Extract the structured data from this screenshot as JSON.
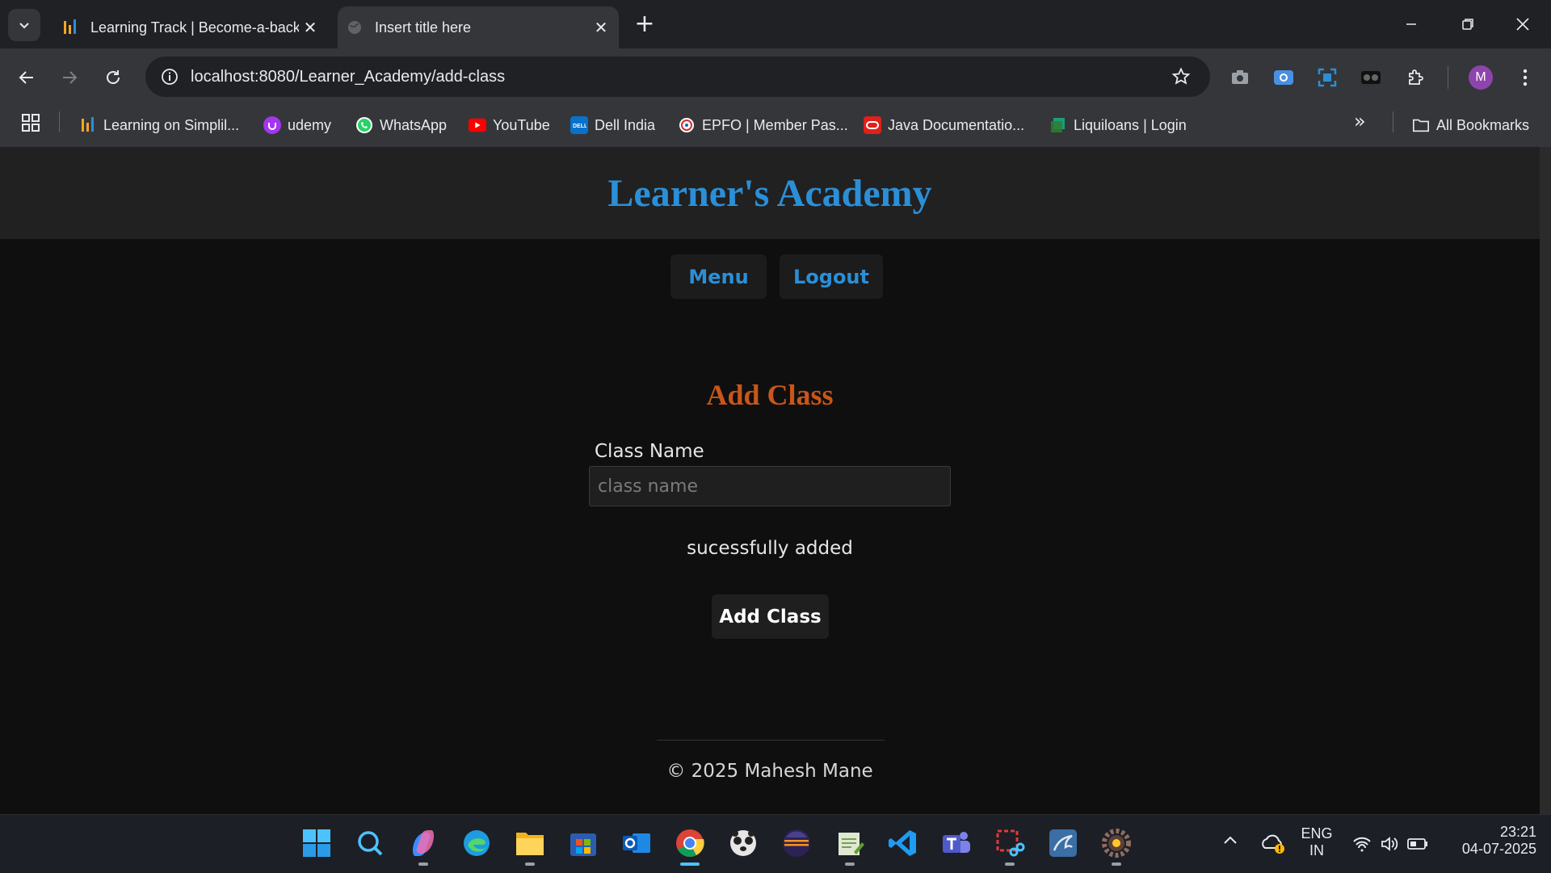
{
  "browser": {
    "tabs": [
      {
        "title": "Learning Track | Become-a-back",
        "active": false
      },
      {
        "title": "Insert title here",
        "active": true
      }
    ],
    "new_tab": "+",
    "url": "localhost:8080/Learner_Academy/add-class",
    "bookmarks": [
      {
        "label": "Learning on Simplil...",
        "icon": "simplilearn-icon"
      },
      {
        "label": "udemy",
        "icon": "udemy-icon"
      },
      {
        "label": "WhatsApp",
        "icon": "whatsapp-icon"
      },
      {
        "label": "YouTube",
        "icon": "youtube-icon"
      },
      {
        "label": "Dell India",
        "icon": "dell-icon"
      },
      {
        "label": "EPFO | Member Pas...",
        "icon": "epfo-icon"
      },
      {
        "label": "Java Documentatio...",
        "icon": "oracle-icon"
      },
      {
        "label": "Liquiloans | Login",
        "icon": "liquiloans-icon"
      }
    ],
    "all_bookmarks": "All Bookmarks",
    "avatar_letter": "M"
  },
  "page": {
    "site_title": "Learner's Academy",
    "nav": {
      "menu": "Menu",
      "logout": "Logout"
    },
    "form_title": "Add Class",
    "class_name_label": "Class Name",
    "class_name_placeholder": "class name",
    "message": "sucessfully added",
    "submit_label": "Add Class",
    "footer": "© 2025 Mahesh Mane"
  },
  "taskbar": {
    "language": "ENG",
    "region": "IN",
    "time": "23:21",
    "date": "04-07-2025"
  },
  "colors": {
    "accent": "#2b8fd8",
    "form_title": "#c8561a",
    "page_bg": "#0f0f0f",
    "header_bg": "#212121"
  }
}
